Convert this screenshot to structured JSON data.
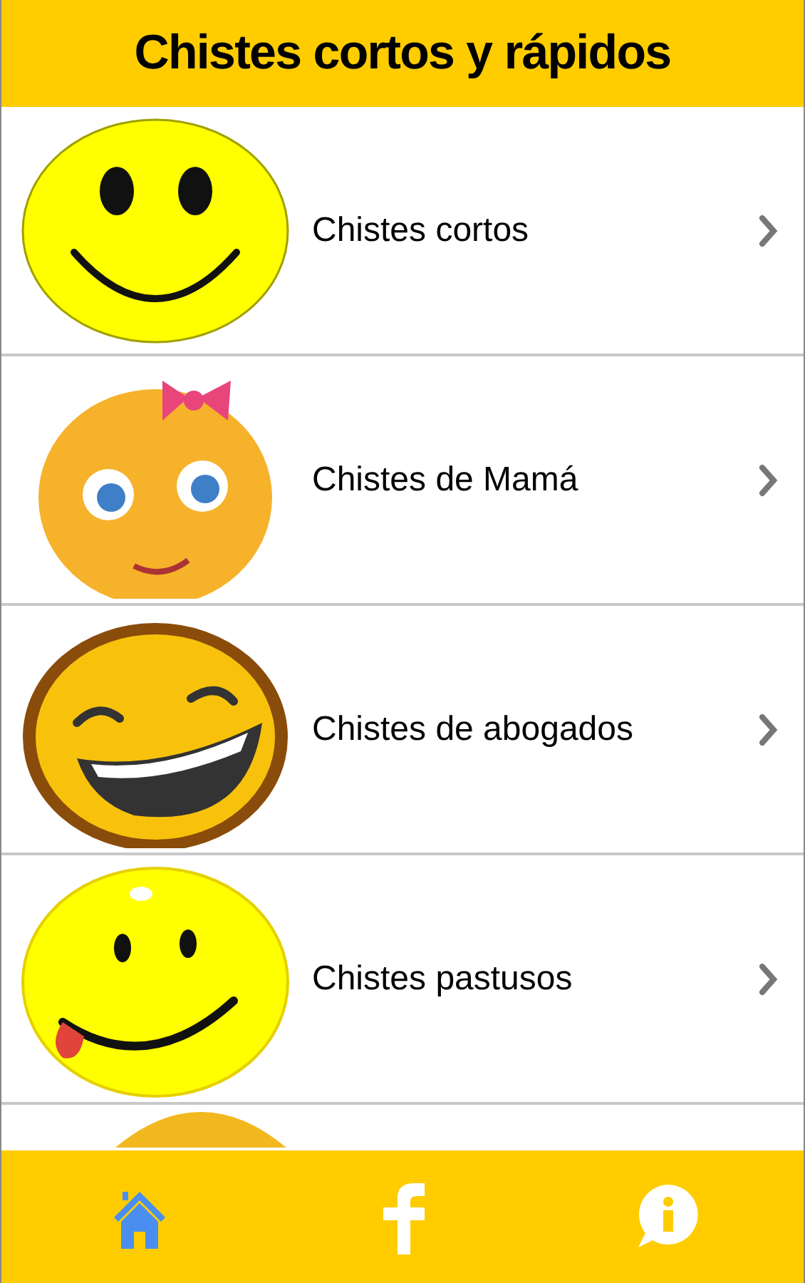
{
  "header": {
    "title": "Chistes cortos y rápidos"
  },
  "categories": [
    {
      "label": "Chistes cortos"
    },
    {
      "label": "Chistes de Mamá"
    },
    {
      "label": "Chistes de abogados"
    },
    {
      "label": "Chistes pastusos"
    }
  ],
  "bottom_nav": [
    {
      "selected": true
    },
    {
      "selected": false
    },
    {
      "selected": false
    }
  ]
}
